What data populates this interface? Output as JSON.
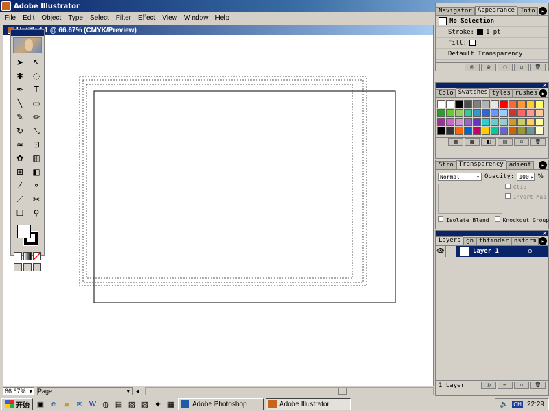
{
  "window": {
    "title": "Adobe Illustrator"
  },
  "menu": [
    "File",
    "Edit",
    "Object",
    "Type",
    "Select",
    "Filter",
    "Effect",
    "View",
    "Window",
    "Help"
  ],
  "document": {
    "title": "Untitled-1 @ 66.67% (CMYK/Preview)"
  },
  "appearance_palette": {
    "tabs": [
      "Navigator",
      "Appearance",
      "Info"
    ],
    "selection": "No Selection",
    "stroke_label": "Stroke:",
    "stroke_value": "1 pt",
    "fill_label": "Fill:",
    "transparency": "Default Transparency"
  },
  "swatches_palette": {
    "tabs": [
      "Colo",
      "Swatches",
      "tyles",
      "rushes"
    ],
    "colors": [
      "#ffffff",
      "#ffffff",
      "#000000",
      "#4d4d4d",
      "#808080",
      "#b3b3b3",
      "#e6e6e6",
      "#ff0000",
      "#ff6633",
      "#ff9933",
      "#ffcc33",
      "#ffff66",
      "#339933",
      "#66cc33",
      "#99cc66",
      "#33cc99",
      "#3399cc",
      "#3366cc",
      "#6699ff",
      "#99ccff",
      "#cc3333",
      "#ff6666",
      "#ff9999",
      "#ffcc99",
      "#993399",
      "#cc66cc",
      "#cc99cc",
      "#9966cc",
      "#6633cc",
      "#33cccc",
      "#66cccc",
      "#99cccc",
      "#cc9933",
      "#cccc66",
      "#ffcc66",
      "#ffff99",
      "#000000",
      "#333333",
      "#ff6600",
      "#0066cc",
      "#cc0066",
      "#ffcc00",
      "#00cc99",
      "#6666cc",
      "#cc6600",
      "#999933",
      "#669999",
      "#ffffcc"
    ]
  },
  "transparency_palette": {
    "tabs": [
      "Stro",
      "Transparency",
      "adient"
    ],
    "blend_mode": "Normal",
    "opacity_label": "Opacity:",
    "opacity_value": "100",
    "opacity_unit": "%",
    "clip": "Clip",
    "invert_mask": "Invert Mas",
    "isolate_blend": "Isolate Blend",
    "knockout_group": "Knockout Group"
  },
  "layers_palette": {
    "tabs": [
      "Layers",
      "gn",
      "thfinder",
      "nsform"
    ],
    "layer_name": "Layer 1",
    "footer_count": "1 Layer"
  },
  "status": {
    "zoom": "66.67%",
    "page": "Page"
  },
  "taskbar": {
    "start": "开始",
    "tasks": [
      "Adobe Photoshop",
      "Adobe Illustrator"
    ],
    "lang": "CH",
    "clock": "22:29"
  }
}
